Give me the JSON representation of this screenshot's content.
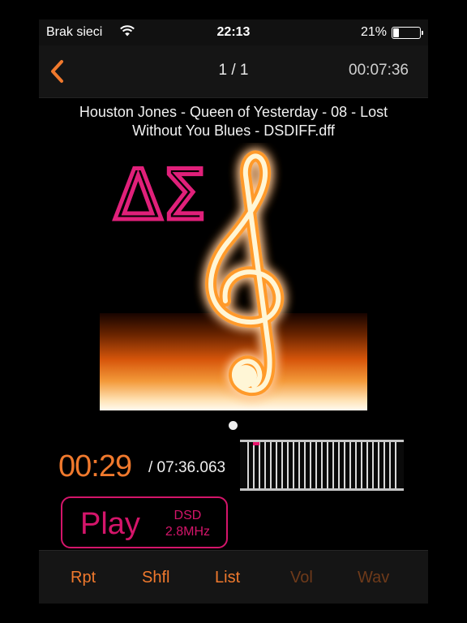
{
  "status_bar": {
    "carrier": "Brak sieci",
    "time": "22:13",
    "battery_percent": "21%",
    "battery_level": 0.21,
    "wifi_icon": "wifi-icon"
  },
  "nav": {
    "back_icon": "chevron-left-icon",
    "counter": "1 / 1",
    "duration": "00:07:36"
  },
  "track": {
    "title": "Houston Jones - Queen of Yesterday - 08 - Lost Without You Blues - DSDIFF.dff"
  },
  "artwork": {
    "logo_text": "ΔΣ",
    "logo_color": "#e0207a",
    "symbol": "treble-clef"
  },
  "pager": {
    "current_page": 1,
    "total_pages": 1
  },
  "playback": {
    "elapsed": "00:29",
    "total": "/ 07:36.063",
    "progress_fraction": 0.063
  },
  "play_button": {
    "label": "Play",
    "format": "DSD",
    "rate": "2.8MHz"
  },
  "tabs": [
    {
      "label": "Rpt",
      "enabled": true
    },
    {
      "label": "Shfl",
      "enabled": true
    },
    {
      "label": "List",
      "enabled": true
    },
    {
      "label": "Vol",
      "enabled": false
    },
    {
      "label": "Wav",
      "enabled": false
    }
  ],
  "colors": {
    "accent_orange": "#f0792d",
    "accent_pink": "#d4156a",
    "background": "#000000"
  }
}
